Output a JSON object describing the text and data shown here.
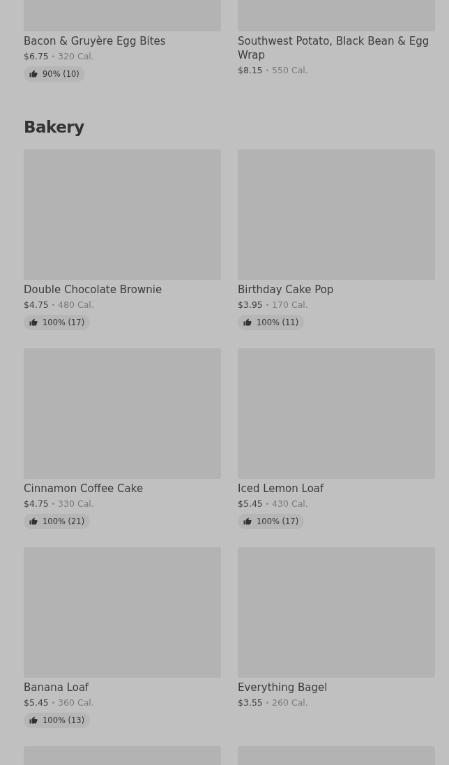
{
  "sections": [
    {
      "items": [
        {
          "kind": "full",
          "name": "Bacon & Gruyère Egg Bites",
          "price": "$6.75",
          "separator": "•",
          "calories": "320 Cal.",
          "rating": "90% (10)"
        },
        {
          "kind": "full",
          "name": "Southwest Potato, Black Bean & Egg Wrap",
          "price": "$8.15",
          "separator": "•",
          "calories": "550 Cal."
        }
      ]
    },
    {
      "title": "Bakery",
      "items": [
        {
          "kind": "full",
          "name": "Double Chocolate Brownie",
          "price": "$4.75",
          "separator": "•",
          "calories": "480 Cal.",
          "rating": "100% (17)"
        },
        {
          "kind": "full",
          "name": "Birthday Cake Pop",
          "price": "$3.95",
          "separator": "•",
          "calories": "170 Cal.",
          "rating": "100% (11)"
        },
        {
          "kind": "full",
          "name": "Cinnamon Coffee Cake",
          "price": "$4.75",
          "separator": "•",
          "calories": "330 Cal.",
          "rating": "100% (21)"
        },
        {
          "kind": "full",
          "name": "Iced Lemon Loaf",
          "price": "$5.45",
          "separator": "•",
          "calories": "430 Cal.",
          "rating": "100% (17)"
        },
        {
          "kind": "full",
          "name": "Banana Loaf",
          "price": "$5.45",
          "separator": "•",
          "calories": "360 Cal.",
          "rating": "100% (13)"
        },
        {
          "kind": "full",
          "name": "Everything Bagel",
          "price": "$3.55",
          "separator": "•",
          "calories": "260 Cal."
        },
        {
          "kind": "image_only"
        },
        {
          "kind": "image_only"
        }
      ]
    }
  ]
}
